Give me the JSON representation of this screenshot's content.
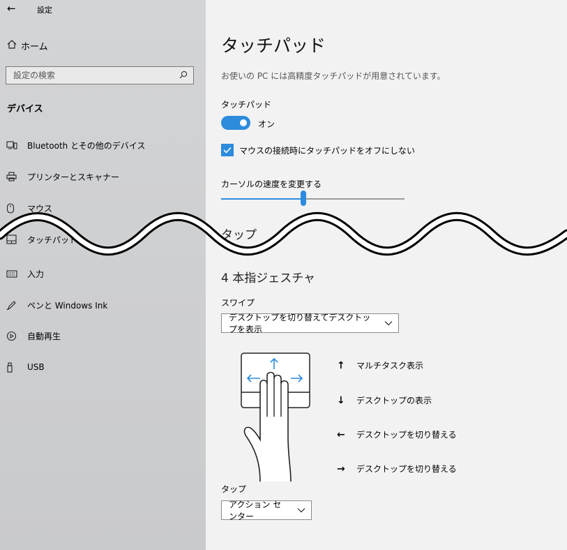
{
  "sidebar": {
    "back_glyph": "←",
    "title": "設定",
    "home_label": "ホーム",
    "search_placeholder": "設定の検索",
    "section_title": "デバイス",
    "items": [
      {
        "label": "Bluetooth とその他のデバイス",
        "icon": "bluetooth-devices-icon"
      },
      {
        "label": "プリンターとスキャナー",
        "icon": "printer-icon"
      },
      {
        "label": "マウス",
        "icon": "mouse-icon"
      },
      {
        "label": "タッチパッド",
        "icon": "touchpad-icon"
      },
      {
        "label": "入力",
        "icon": "keyboard-icon"
      },
      {
        "label": "ペンと Windows Ink",
        "icon": "pen-icon"
      },
      {
        "label": "自動再生",
        "icon": "autoplay-icon"
      },
      {
        "label": "USB",
        "icon": "usb-icon"
      }
    ]
  },
  "main": {
    "title": "タッチパッド",
    "description": "お使いの PC には高精度タッチパッドが用意されています。",
    "touchpad_label": "タッチパッド",
    "toggle_state": "オン",
    "checkbox_label": "マウスの接続時にタッチパッドをオフにしない",
    "cursor_speed_label": "カーソルの速度を変更する",
    "cursor_speed_fraction": 0.45,
    "partial_heading": "タップ",
    "four_finger_heading": "4 本指ジェスチャ",
    "swipe_label": "スワイプ",
    "swipe_value": "デスクトップを切り替えてデスクトップを表示",
    "gestures": [
      {
        "arrow": "↑",
        "label": "マルチタスク表示"
      },
      {
        "arrow": "↓",
        "label": "デスクトップの表示"
      },
      {
        "arrow": "←",
        "label": "デスクトップを切り替える"
      },
      {
        "arrow": "→",
        "label": "デスクトップを切り替える"
      }
    ],
    "tap_label": "タップ",
    "tap_value": "アクション センター"
  },
  "colors": {
    "accent": "#2c8bdc",
    "sidebar_bg": "#cfd0d2",
    "main_bg": "#f2f2f2"
  }
}
